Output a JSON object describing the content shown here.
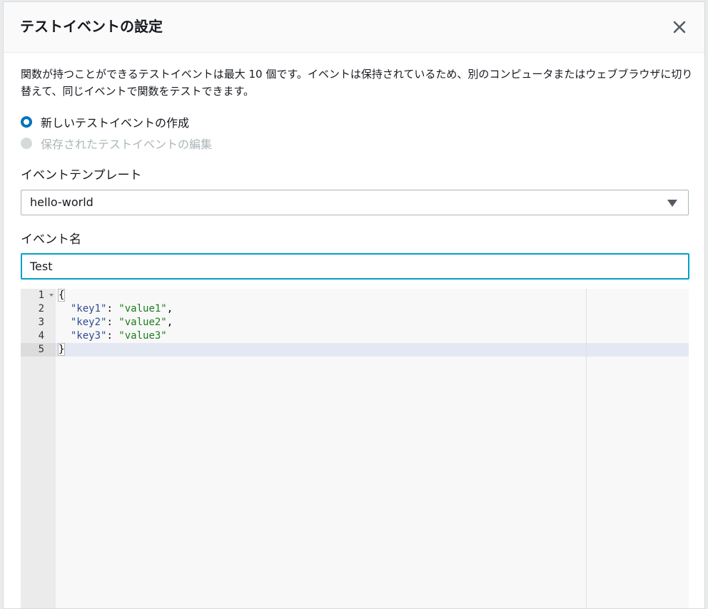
{
  "modal": {
    "title": "テストイベントの設定",
    "close_icon": "close-icon"
  },
  "description": "関数が持つことができるテストイベントは最大 10 個です。イベントは保持されているため、別のコンピュータまたはウェブブラウザに切り替えて、同じイベントで関数をテストできます。",
  "radios": {
    "create_label": "新しいテストイベントの作成",
    "create_selected": true,
    "edit_label": "保存されたテストイベントの編集",
    "edit_disabled": true
  },
  "template": {
    "label": "イベントテンプレート",
    "value": "hello-world"
  },
  "event_name": {
    "label": "イベント名",
    "value": "Test"
  },
  "editor": {
    "line_numbers": [
      "1",
      "2",
      "3",
      "4",
      "5"
    ],
    "active_line": 5,
    "lines": [
      {
        "text": "{"
      },
      {
        "key": "\"key1\"",
        "value": "\"value1\"",
        "comma": ","
      },
      {
        "key": "\"key2\"",
        "value": "\"value2\"",
        "comma": ","
      },
      {
        "key": "\"key3\"",
        "value": "\"value3\"",
        "comma": ""
      },
      {
        "text": "}"
      }
    ]
  },
  "colors": {
    "accent": "#0073bb",
    "focus": "#00a1c9",
    "json_key": "#2e4b94",
    "json_string": "#1a7d1a"
  }
}
